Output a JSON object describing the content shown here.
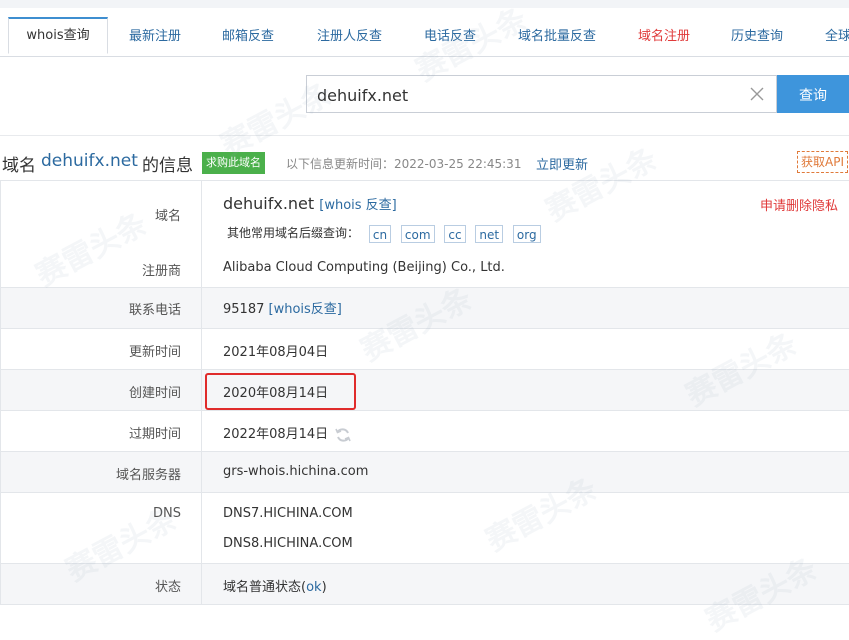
{
  "tabs": [
    "whois查询",
    "最新注册",
    "邮箱反查",
    "注册人反查",
    "电话反查",
    "域名批量反查",
    "域名注册",
    "历史查询",
    "全球"
  ],
  "search": {
    "value": "dehuifx.net",
    "button": "查询"
  },
  "header": {
    "prefix": "域名",
    "domain": "dehuifx.net",
    "suffix": "的信息",
    "buy_badge": "求购此域名",
    "update_text": "以下信息更新时间：2022-03-25 22:45:31",
    "update_link": "立即更新",
    "api_button": "获取API"
  },
  "rows": {
    "domain": {
      "label": "域名",
      "value": "dehuifx.net",
      "reverse_link": "[whois 反查]",
      "delete_link": "申请删除隐私",
      "suffix_prompt": "其他常用域名后缀查询：",
      "suffixes": [
        "cn",
        "com",
        "cc",
        "net",
        "org"
      ]
    },
    "registrar": {
      "label": "注册商",
      "value": "Alibaba Cloud Computing (Beijing) Co., Ltd."
    },
    "phone": {
      "label": "联系电话",
      "value": "95187",
      "link": "[whois反查]"
    },
    "updated": {
      "label": "更新时间",
      "value": "2021年08月04日"
    },
    "created": {
      "label": "创建时间",
      "value": "2020年08月14日"
    },
    "expires": {
      "label": "过期时间",
      "value": "2022年08月14日"
    },
    "whois_server": {
      "label": "域名服务器",
      "value": "grs-whois.hichina.com"
    },
    "dns": {
      "label": "DNS",
      "values": [
        "DNS7.HICHINA.COM",
        "DNS8.HICHINA.COM"
      ]
    },
    "status": {
      "label": "状态",
      "value": "域名普通状态(",
      "link": "ok",
      "close": ")"
    }
  },
  "watermark": "赛雷头条",
  "colors": {
    "link": "#2c6aa0",
    "accent": "#3e95dc",
    "badge": "#4bb04b",
    "alert": "#e03a3a"
  }
}
